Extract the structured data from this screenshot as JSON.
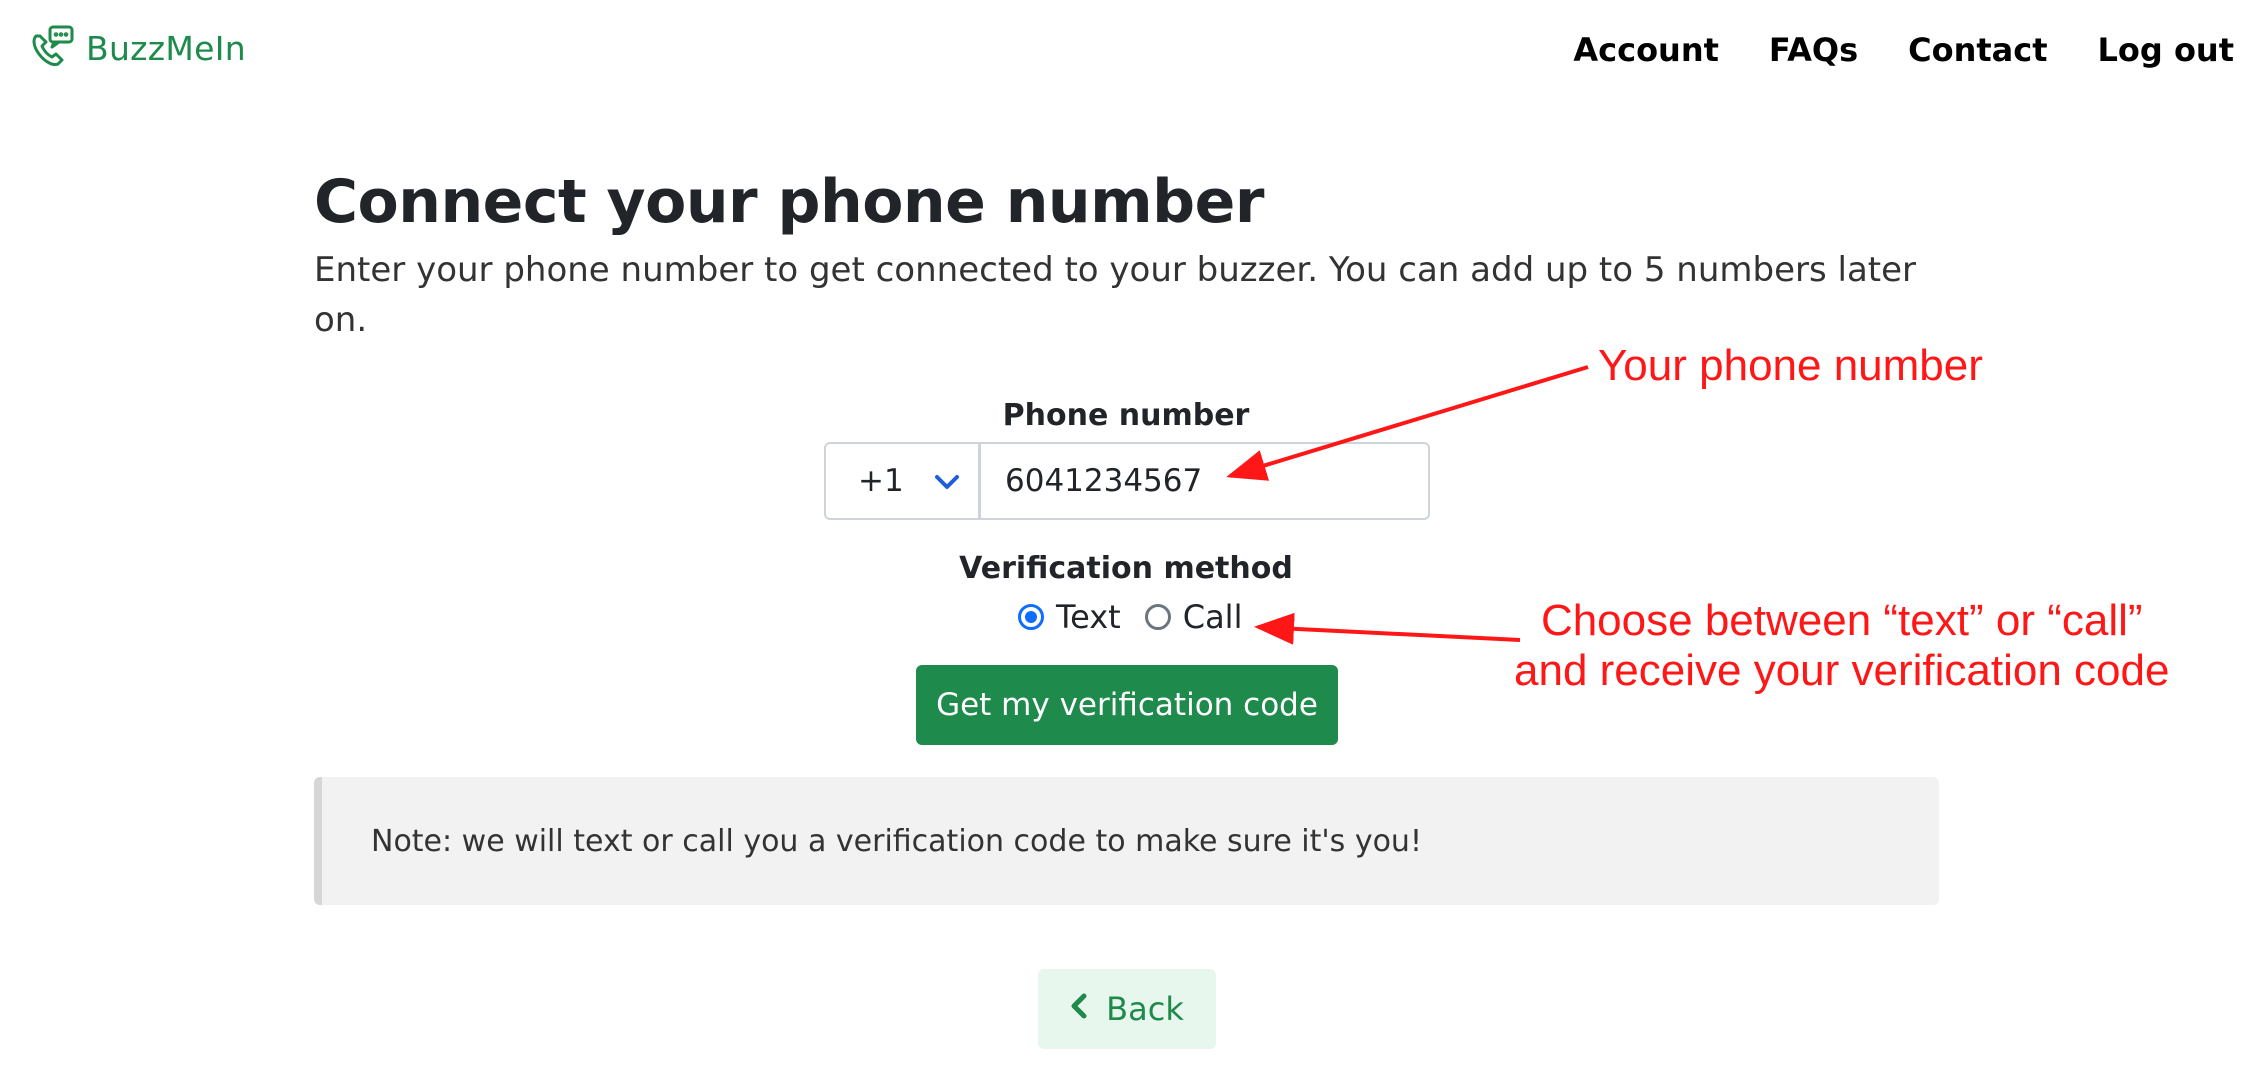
{
  "header": {
    "brand": "BuzzMeIn",
    "nav": [
      "Account",
      "FAQs",
      "Contact",
      "Log out"
    ]
  },
  "main": {
    "title": "Connect your phone number",
    "subtitle": "Enter your phone number to get connected to your buzzer. You can add up to 5 numbers later on.",
    "phone_label": "Phone number",
    "country_code": "+1",
    "phone_value": "6041234567",
    "verification_label": "Verification method",
    "options": [
      {
        "label": "Text",
        "checked": true
      },
      {
        "label": "Call",
        "checked": false
      }
    ],
    "submit_label": "Get my verification code",
    "note": "Note: we will text or call you a verification code to make sure it's you!",
    "back_label": "Back"
  },
  "annotations": {
    "phone": "Your phone number",
    "verification_line1": "Choose between “text” or “call”",
    "verification_line2": "and receive your verification code"
  },
  "colors": {
    "brand_green": "#1e8a4c",
    "annotation_red": "#ff1616",
    "radio_blue": "#0d6efd"
  },
  "icons": [
    "phone-chat-icon",
    "chevron-down-icon",
    "chevron-left-icon"
  ]
}
